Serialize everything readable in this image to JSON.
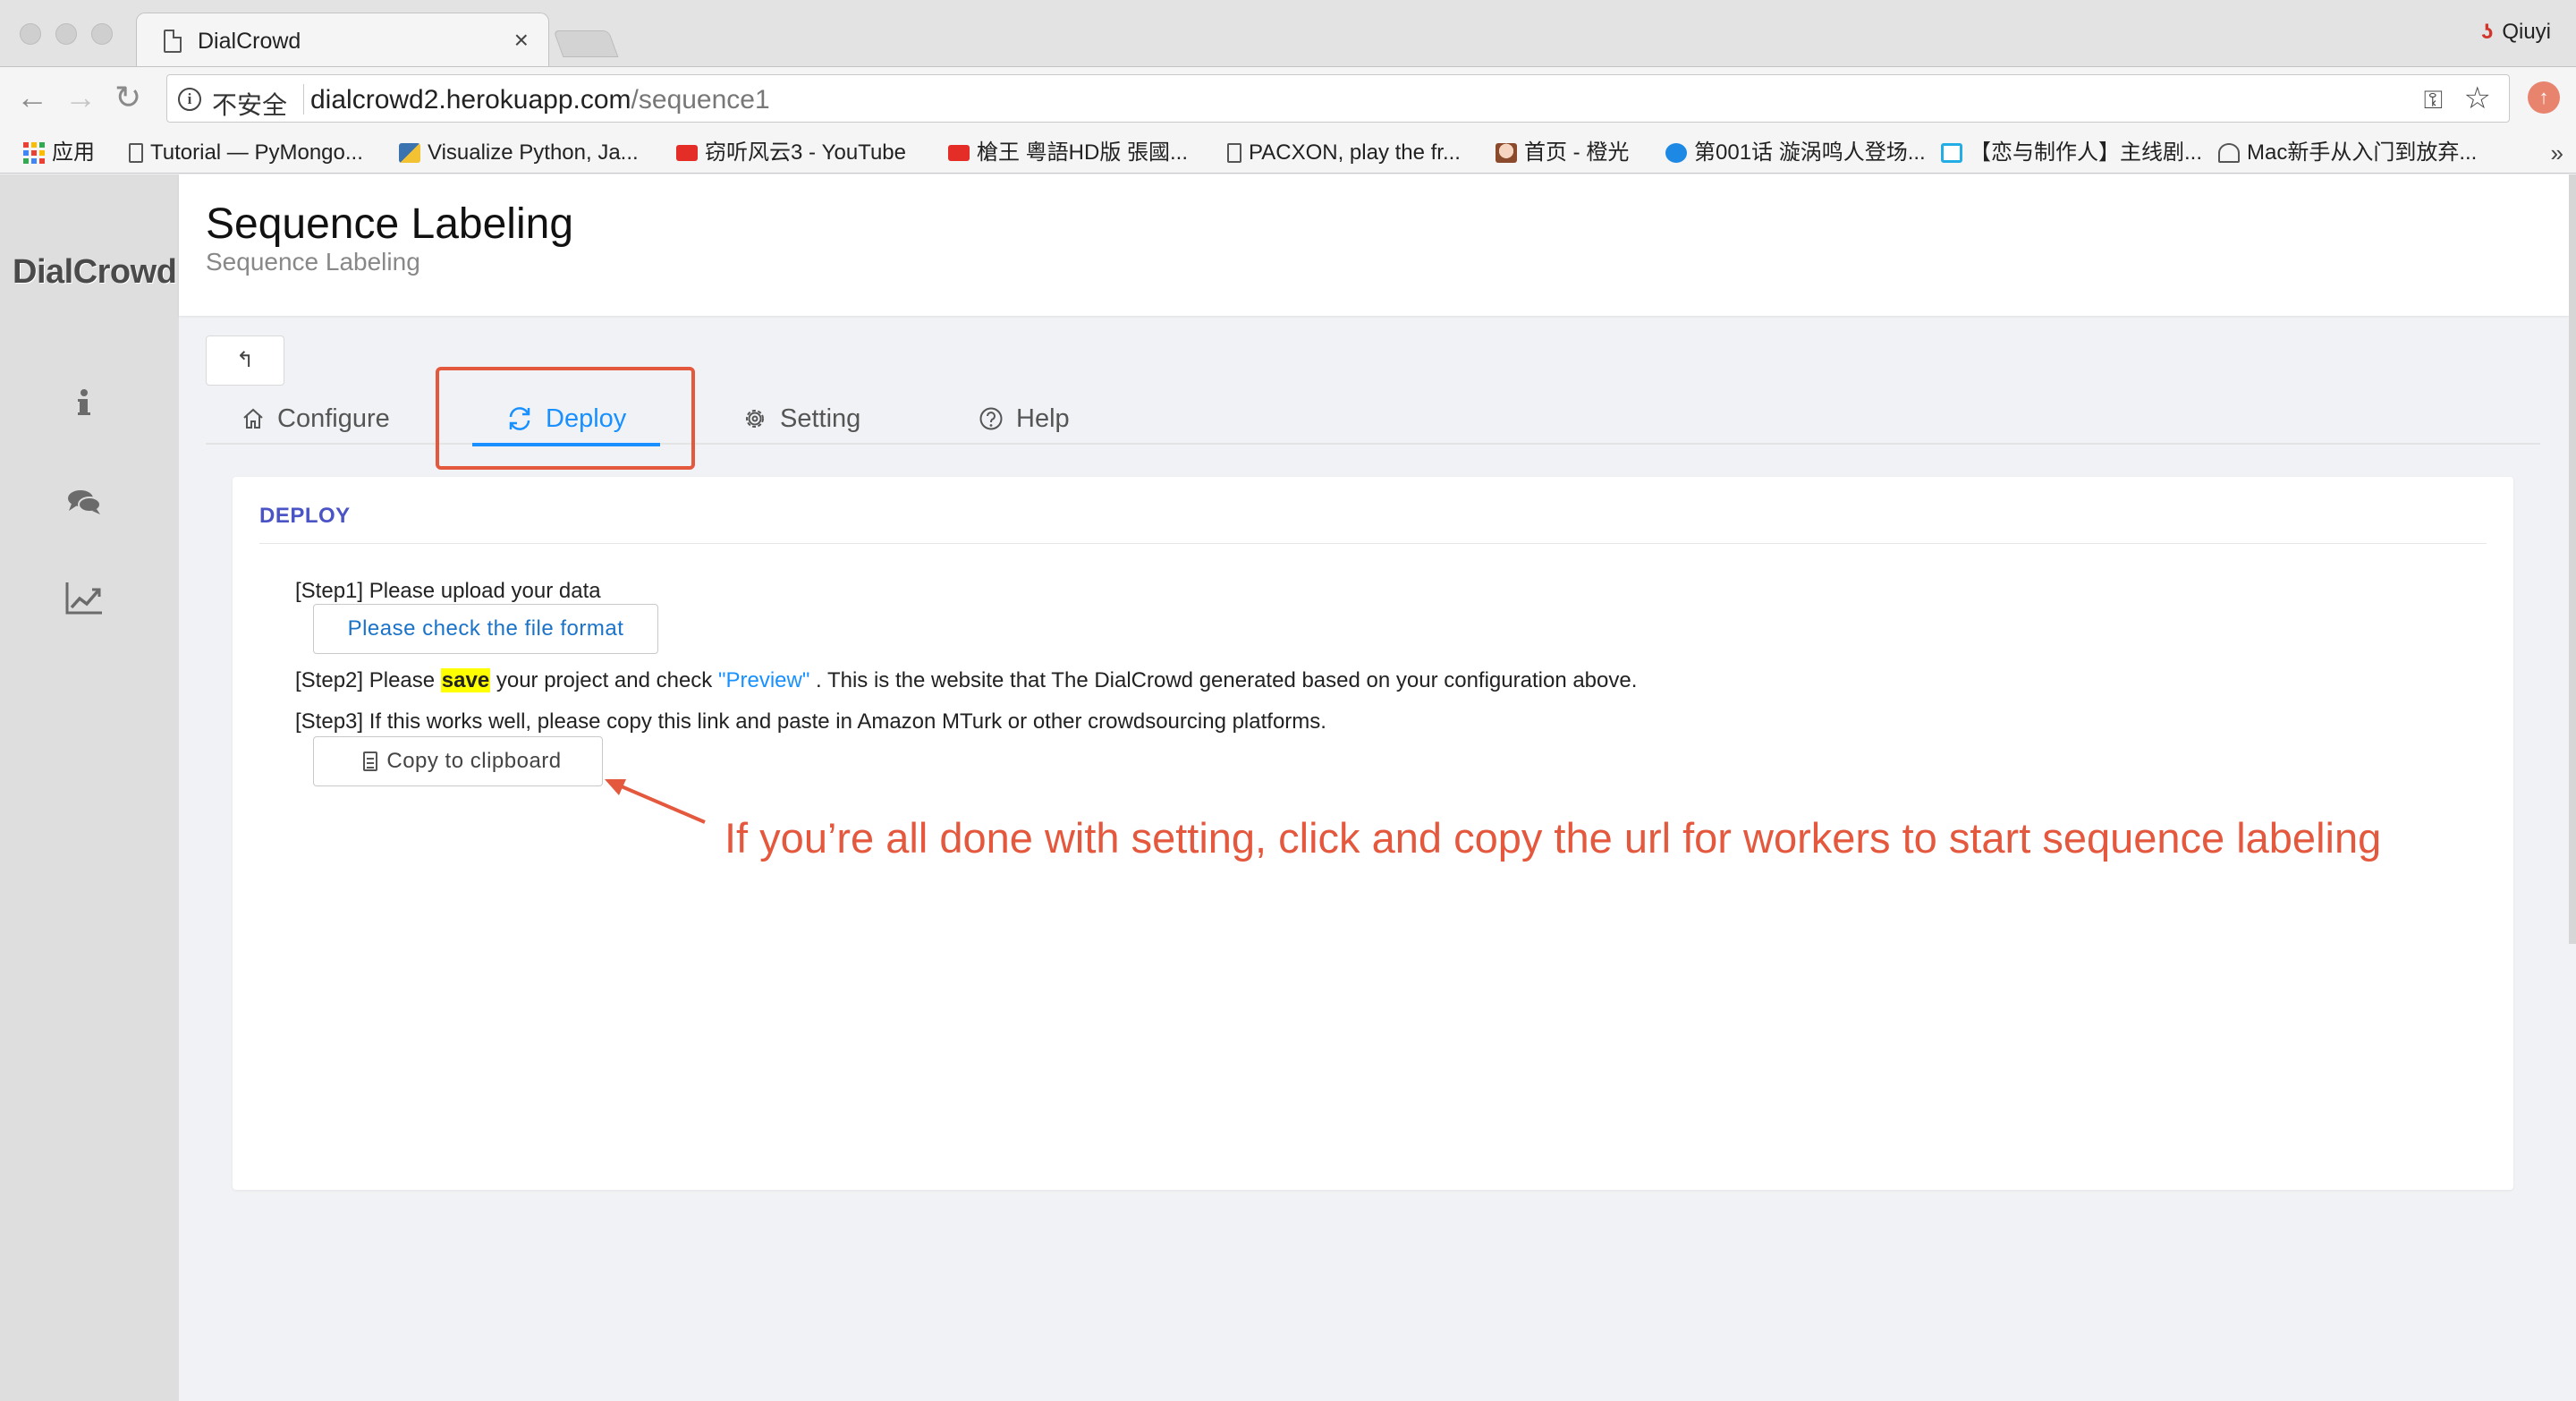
{
  "browser": {
    "tab_title": "DialCrowd",
    "tab_close": "×",
    "profile_name": "Qiuyi",
    "security_label": "不安全",
    "url_host": "dialcrowd2.herokuapp.com",
    "url_path": "/sequence1",
    "bookmarks": [
      {
        "label": "应用",
        "icon": "apps-grid-icon"
      },
      {
        "label": "Tutorial — PyMongo...",
        "icon": "document-icon"
      },
      {
        "label": "Visualize Python, Ja...",
        "icon": "python-icon"
      },
      {
        "label": "窃听风云3 - YouTube",
        "icon": "youtube-icon"
      },
      {
        "label": "槍王 粵語HD版 張國...",
        "icon": "youtube-icon"
      },
      {
        "label": "PACXON, play the fr...",
        "icon": "document-icon"
      },
      {
        "label": "首页 - 橙光",
        "icon": "anime-avatar-icon"
      },
      {
        "label": "第001话 漩涡鸣人登场...",
        "icon": "video-play-icon"
      },
      {
        "label": "【恋与制作人】主线剧...",
        "icon": "bilibili-icon"
      },
      {
        "label": "Mac新手从入门到放弃...",
        "icon": "climber-icon"
      }
    ],
    "bookmarks_more": "»"
  },
  "app": {
    "logo": "DialCrowd",
    "page_title": "Sequence Labeling",
    "page_subtitle": "Sequence Labeling",
    "back_label": "↰",
    "tabs": [
      {
        "label": "Configure",
        "icon": "home-icon",
        "active": false
      },
      {
        "label": "Deploy",
        "icon": "sync-icon",
        "active": true
      },
      {
        "label": "Setting",
        "icon": "gear-icon",
        "active": false
      },
      {
        "label": "Help",
        "icon": "question-circle-icon",
        "active": false
      }
    ],
    "deploy": {
      "heading": "DEPLOY",
      "step1": "[Step1] Please upload your data",
      "check_format_button": "Please check the file format",
      "step2_prefix": "[Step2] Please ",
      "step2_highlight": "save",
      "step2_mid": " your project and check ",
      "step2_link": "\"Preview\"",
      "step2_suffix": " . This is the website that The DialCrowd generated based on your configuration above.",
      "step3": "[Step3] If this works well, please copy this link and paste in Amazon MTurk or other crowdsourcing platforms.",
      "copy_button": "Copy to clipboard"
    },
    "annotation_text": "If you’re all done with setting, click and copy the url for workers to start sequence labeling",
    "annotation_color": "#e4583e",
    "accent_color": "#1890ff"
  }
}
